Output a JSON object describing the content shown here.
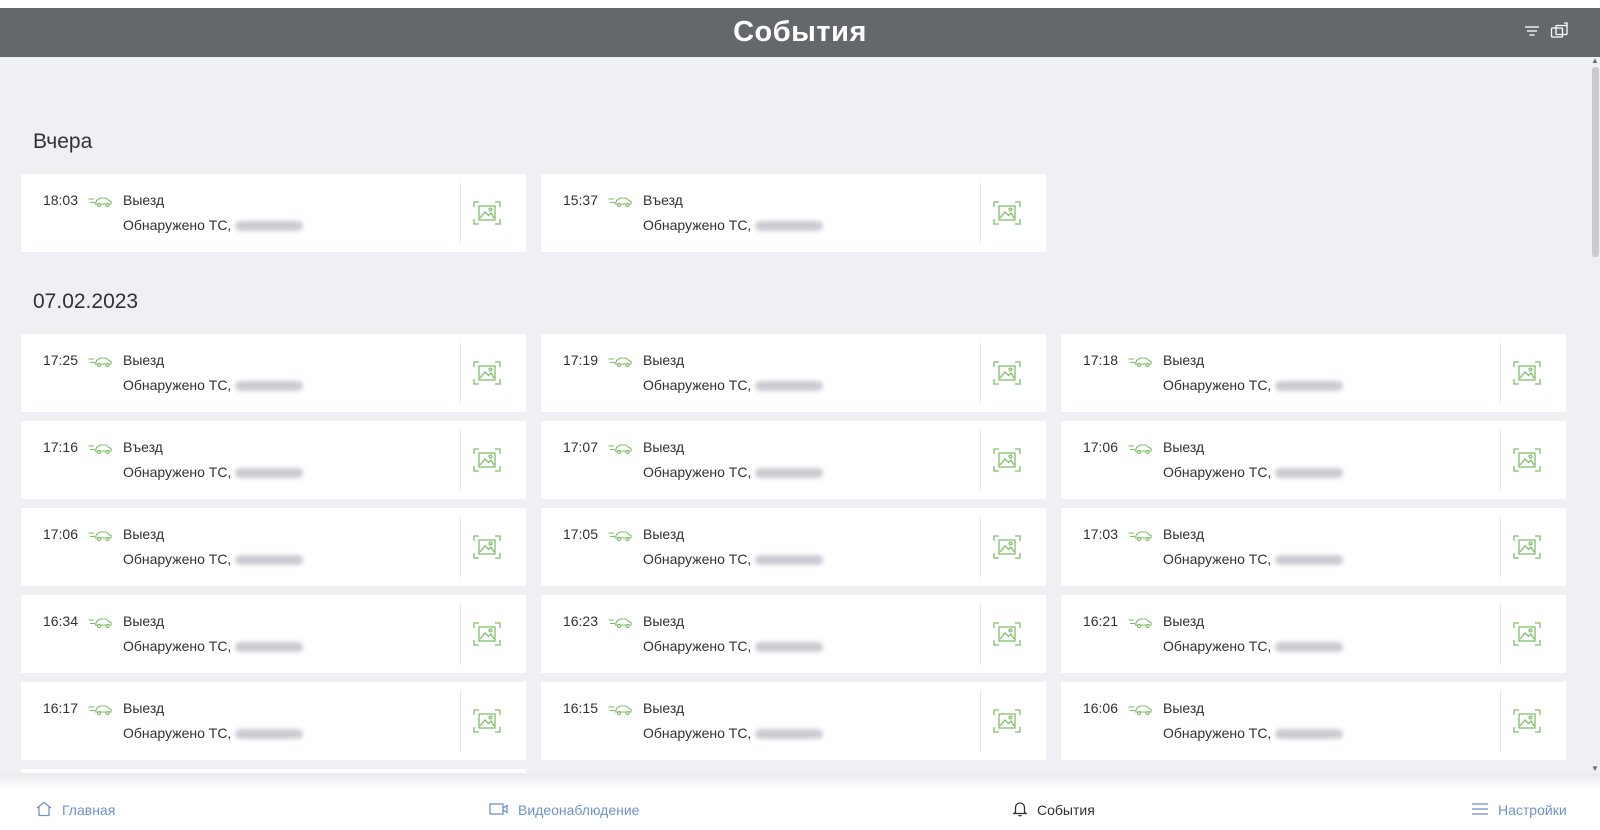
{
  "header": {
    "title": "События",
    "icons": [
      "filter-icon",
      "export-icon"
    ]
  },
  "colors": {
    "header_bg": "#64676c",
    "content_bg": "#eef0f4",
    "accent_green": "#7fbf6a",
    "nav_link": "#6f93c8"
  },
  "sections": [
    {
      "title": "Вчера",
      "events": [
        {
          "time": "18:03",
          "type": "Выезд",
          "desc": "Обнаружено ТС,"
        },
        {
          "time": "15:37",
          "type": "Въезд",
          "desc": "Обнаружено ТС,"
        }
      ]
    },
    {
      "title": "07.02.2023",
      "events": [
        {
          "time": "17:25",
          "type": "Выезд",
          "desc": "Обнаружено ТС,"
        },
        {
          "time": "17:19",
          "type": "Выезд",
          "desc": "Обнаружено ТС,"
        },
        {
          "time": "17:18",
          "type": "Выезд",
          "desc": "Обнаружено ТС,"
        },
        {
          "time": "17:16",
          "type": "Въезд",
          "desc": "Обнаружено ТС,"
        },
        {
          "time": "17:07",
          "type": "Выезд",
          "desc": "Обнаружено ТС,"
        },
        {
          "time": "17:06",
          "type": "Выезд",
          "desc": "Обнаружено ТС,"
        },
        {
          "time": "17:06",
          "type": "Выезд",
          "desc": "Обнаружено ТС,"
        },
        {
          "time": "17:05",
          "type": "Выезд",
          "desc": "Обнаружено ТС,"
        },
        {
          "time": "17:03",
          "type": "Выезд",
          "desc": "Обнаружено ТС,"
        },
        {
          "time": "16:34",
          "type": "Выезд",
          "desc": "Обнаружено ТС,"
        },
        {
          "time": "16:23",
          "type": "Выезд",
          "desc": "Обнаружено ТС,"
        },
        {
          "time": "16:21",
          "type": "Выезд",
          "desc": "Обнаружено ТС,"
        },
        {
          "time": "16:17",
          "type": "Выезд",
          "desc": "Обнаружено ТС,"
        },
        {
          "time": "16:15",
          "type": "Выезд",
          "desc": "Обнаружено ТС,"
        },
        {
          "time": "16:06",
          "type": "Выезд",
          "desc": "Обнаружено ТС,"
        }
      ]
    }
  ],
  "bottom_nav": [
    {
      "label": "Главная",
      "icon": "home-icon",
      "active": false
    },
    {
      "label": "Видеонаблюдение",
      "icon": "camera-icon",
      "active": false
    },
    {
      "label": "События",
      "icon": "bell-icon",
      "active": true
    },
    {
      "label": "Настройки",
      "icon": "menu-icon",
      "active": false
    }
  ]
}
